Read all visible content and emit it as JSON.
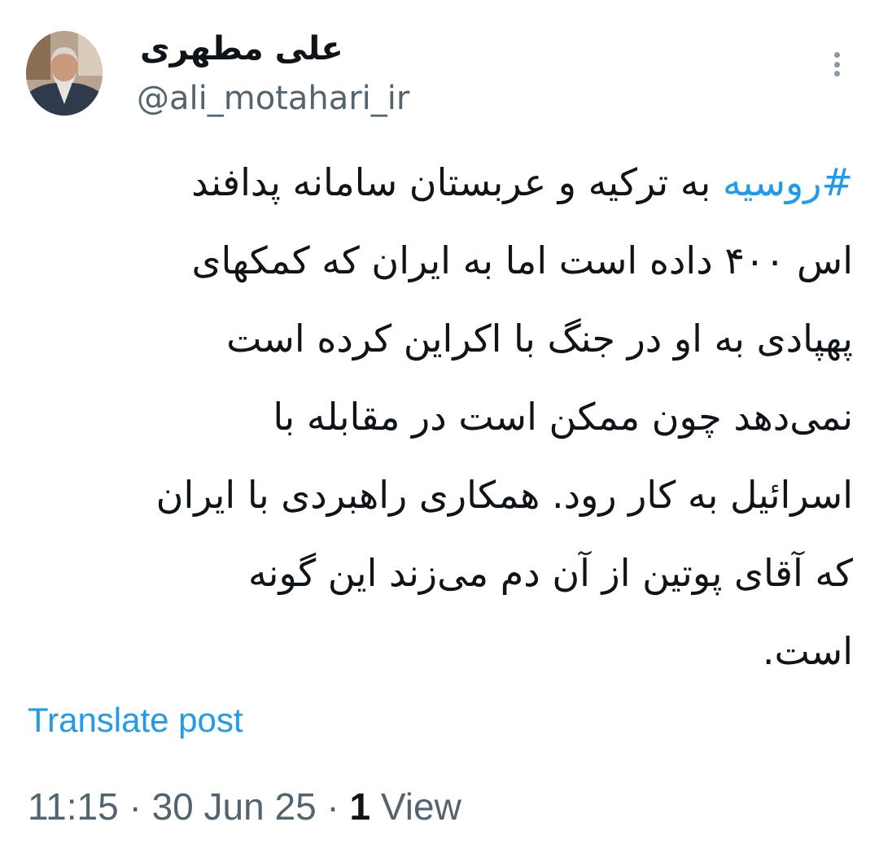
{
  "author": {
    "display_name": "علی مطهری",
    "handle": "@ali_motahari_ir"
  },
  "tweet": {
    "hashtag": "#روسیه",
    "lines": [
      " به ترکیه و عربستان سامانه پدافند",
      "اس ۴۰۰ داده است اما به ایران که کمکهای",
      "پهپادی به او در جنگ با اکراین کرده است",
      "نمی‌دهد چون ممکن است در مقابله با",
      "اسرائیل به کار رود. همکاری راهبردی با ایران",
      "که آقای پوتین از آن دم می‌زند این گونه",
      "است."
    ]
  },
  "actions": {
    "translate_label": "Translate post"
  },
  "meta": {
    "time": "11:15",
    "separator": " · ",
    "date": "30 Jun 25",
    "views_count": "1",
    "views_label": " View"
  },
  "icons": {
    "more": "more-vertical-icon"
  },
  "colors": {
    "link": "#1d9bf0",
    "secondary_text": "#536471",
    "primary_text": "#0f1419"
  }
}
